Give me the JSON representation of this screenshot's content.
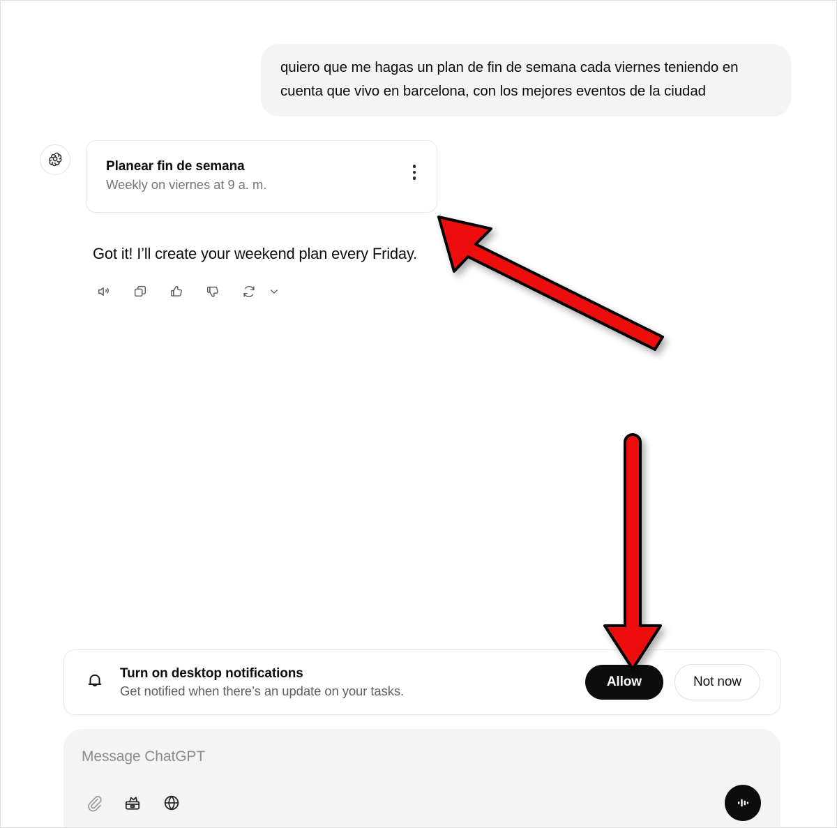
{
  "conversation": {
    "user_message": "quiero que me hagas un plan de fin de semana cada viernes teniendo en cuenta que vivo en barcelona, con los mejores eventos de la ciudad",
    "assistant": {
      "avatar_icon": "openai-logo-icon",
      "task_card": {
        "title": "Planear fin de semana",
        "schedule": "Weekly on viernes at 9 a. m.",
        "menu_icon": "kebab-menu-icon"
      },
      "reply_text": "Got it! I’ll create your weekend plan every Friday.",
      "actions": [
        {
          "name": "read-aloud",
          "icon": "speaker-icon"
        },
        {
          "name": "copy",
          "icon": "copy-icon"
        },
        {
          "name": "good-response",
          "icon": "thumbs-up-icon"
        },
        {
          "name": "bad-response",
          "icon": "thumbs-down-icon"
        },
        {
          "name": "regenerate",
          "icon": "refresh-icon"
        },
        {
          "name": "regenerate-menu",
          "icon": "chevron-down-icon"
        }
      ]
    }
  },
  "notification_banner": {
    "icon": "bell-icon",
    "title": "Turn on desktop notifications",
    "subtitle": "Get notified when there’s an update on your tasks.",
    "allow_label": "Allow",
    "not_now_label": "Not now"
  },
  "composer": {
    "placeholder": "Message ChatGPT",
    "tools": [
      {
        "name": "attach-file",
        "icon": "paperclip-icon"
      },
      {
        "name": "tools",
        "icon": "toolbox-icon"
      },
      {
        "name": "search-web",
        "icon": "globe-icon"
      }
    ],
    "voice_button_icon": "voice-waveform-icon"
  },
  "annotations": {
    "arrow_color": "#ee1111",
    "arrow_outline_color": "#000000",
    "arrows": [
      {
        "name": "arrow-to-task-card",
        "direction": "up-left",
        "points_to": "task-card"
      },
      {
        "name": "arrow-to-allow-button",
        "direction": "down",
        "points_to": "allow-button"
      }
    ]
  },
  "theme": {
    "background": "#ffffff",
    "bubble_gray": "#f4f4f4",
    "text_primary": "#0d0d0d",
    "text_muted": "#76767a",
    "accent_black": "#0d0d0d",
    "border_light": "#e8e8e8"
  }
}
